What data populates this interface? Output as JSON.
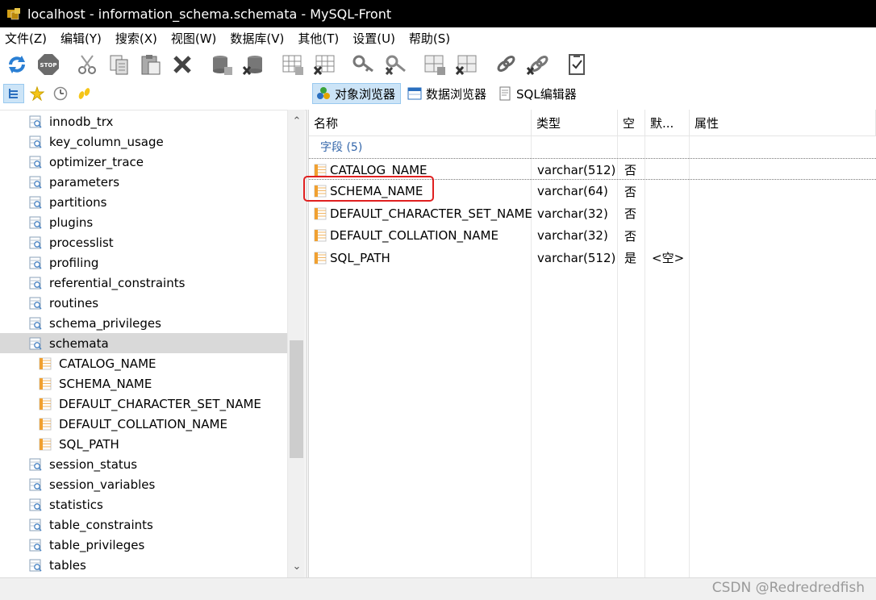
{
  "window": {
    "title": "localhost - information_schema.schemata - MySQL-Front"
  },
  "menu": [
    "文件(Z)",
    "编辑(Y)",
    "搜索(X)",
    "视图(W)",
    "数据库(V)",
    "其他(T)",
    "设置(U)",
    "帮助(S)"
  ],
  "toolbar": {
    "icons": [
      "refresh-icon",
      "stop-icon",
      "cut-icon",
      "copy-icon",
      "paste-icon",
      "delete-icon",
      "database-add-icon",
      "database-delete-icon",
      "table-add-icon",
      "table-delete-icon",
      "key-add-icon",
      "key-delete-icon",
      "grid-add-icon",
      "grid-delete-icon",
      "link-add-icon",
      "link-delete-icon",
      "checklist-icon"
    ],
    "stop_label": "STOP"
  },
  "view_tabs": {
    "object_browser": "对象浏览器",
    "data_browser": "数据浏览器",
    "sql_editor": "SQL编辑器"
  },
  "tree": {
    "items": [
      {
        "label": "innodb_trx",
        "level": 1,
        "kind": "table"
      },
      {
        "label": "key_column_usage",
        "level": 1,
        "kind": "table"
      },
      {
        "label": "optimizer_trace",
        "level": 1,
        "kind": "table"
      },
      {
        "label": "parameters",
        "level": 1,
        "kind": "table"
      },
      {
        "label": "partitions",
        "level": 1,
        "kind": "table"
      },
      {
        "label": "plugins",
        "level": 1,
        "kind": "table"
      },
      {
        "label": "processlist",
        "level": 1,
        "kind": "table"
      },
      {
        "label": "profiling",
        "level": 1,
        "kind": "table"
      },
      {
        "label": "referential_constraints",
        "level": 1,
        "kind": "table"
      },
      {
        "label": "routines",
        "level": 1,
        "kind": "table"
      },
      {
        "label": "schema_privileges",
        "level": 1,
        "kind": "table"
      },
      {
        "label": "schemata",
        "level": 1,
        "kind": "table",
        "selected": true
      },
      {
        "label": "CATALOG_NAME",
        "level": 2,
        "kind": "field"
      },
      {
        "label": "SCHEMA_NAME",
        "level": 2,
        "kind": "field"
      },
      {
        "label": "DEFAULT_CHARACTER_SET_NAME",
        "level": 2,
        "kind": "field"
      },
      {
        "label": "DEFAULT_COLLATION_NAME",
        "level": 2,
        "kind": "field"
      },
      {
        "label": "SQL_PATH",
        "level": 2,
        "kind": "field"
      },
      {
        "label": "session_status",
        "level": 1,
        "kind": "table"
      },
      {
        "label": "session_variables",
        "level": 1,
        "kind": "table"
      },
      {
        "label": "statistics",
        "level": 1,
        "kind": "table"
      },
      {
        "label": "table_constraints",
        "level": 1,
        "kind": "table"
      },
      {
        "label": "table_privileges",
        "level": 1,
        "kind": "table"
      },
      {
        "label": "tables",
        "level": 1,
        "kind": "table"
      }
    ]
  },
  "grid": {
    "headers": [
      "名称",
      "类型",
      "空",
      "默...",
      "属性"
    ],
    "group_label": "字段 (5)",
    "rows": [
      {
        "name": "CATALOG_NAME",
        "type": "varchar(512)",
        "null": "否",
        "default": ""
      },
      {
        "name": "SCHEMA_NAME",
        "type": "varchar(64)",
        "null": "否",
        "default": ""
      },
      {
        "name": "DEFAULT_CHARACTER_SET_NAME",
        "type": "varchar(32)",
        "null": "否",
        "default": ""
      },
      {
        "name": "DEFAULT_COLLATION_NAME",
        "type": "varchar(32)",
        "null": "否",
        "default": ""
      },
      {
        "name": "SQL_PATH",
        "type": "varchar(512)",
        "null": "是",
        "default": "<空>"
      }
    ]
  },
  "scrollbar": {
    "up": "⌃",
    "down": "⌄"
  },
  "watermark": "CSDN @Redredredfish",
  "colors": {
    "highlight": "#e02020",
    "group_label": "#3366aa",
    "selection": "#d9d9d9"
  }
}
